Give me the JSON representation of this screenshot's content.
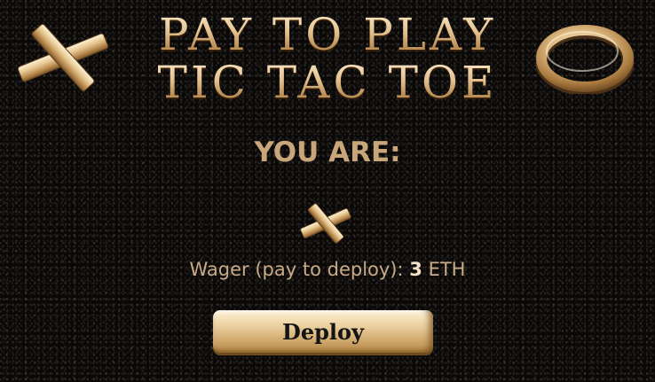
{
  "header": {
    "title_line1": "PAY TO PLAY",
    "title_line2": "TIC TAC TOE"
  },
  "decor": {
    "left_icon": "gold-x-piece",
    "right_icon": "gold-o-ring"
  },
  "player": {
    "label": "YOU ARE:",
    "mark_icon": "gold-x-piece"
  },
  "wager": {
    "label": "Wager (pay to deploy):",
    "amount": "3",
    "unit": "ETH"
  },
  "actions": {
    "deploy_label": "Deploy"
  },
  "colors": {
    "background": "#0b0908",
    "gold_light": "#fbe7c6",
    "gold_mid": "#e2c08e",
    "gold_dark": "#b98b52",
    "label_tan": "#c9a57a",
    "button_text": "#141414"
  }
}
